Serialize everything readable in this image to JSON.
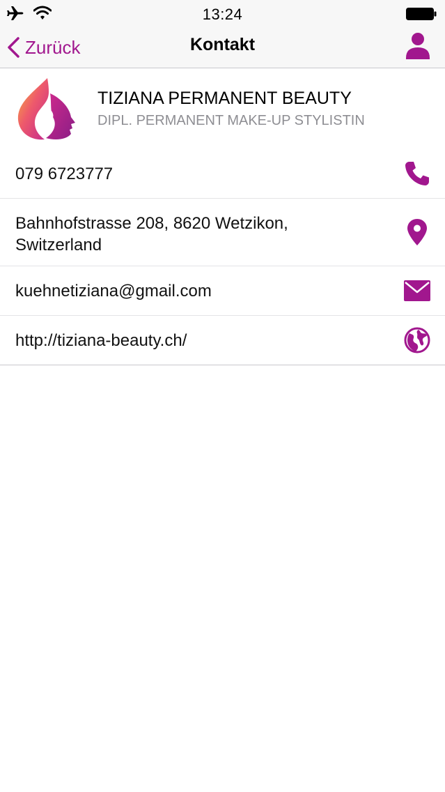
{
  "status_bar": {
    "time": "13:24"
  },
  "nav": {
    "back_label": "Zurück",
    "title": "Kontakt"
  },
  "header": {
    "company_name": "TIZIANA PERMANENT BEAUTY",
    "subtitle": "DIPL. PERMANENT MAKE-UP STYLISTIN"
  },
  "contact": {
    "phone": "079 6723777",
    "address_line1": "Bahnhofstrasse 208, 8620 Wetzikon,",
    "address_line2": "Switzerland",
    "email": "kuehnetiziana@gmail.com",
    "website": "http://tiziana-beauty.ch/"
  },
  "icons": {
    "phone": "phone-icon",
    "address": "map-pin-icon",
    "email": "envelope-icon",
    "website": "globe-icon",
    "profile": "user-icon"
  },
  "colors": {
    "accent": "#a1178e",
    "background": "#ffffff",
    "bar": "#f7f7f7",
    "subtitle": "#8e8e93"
  }
}
